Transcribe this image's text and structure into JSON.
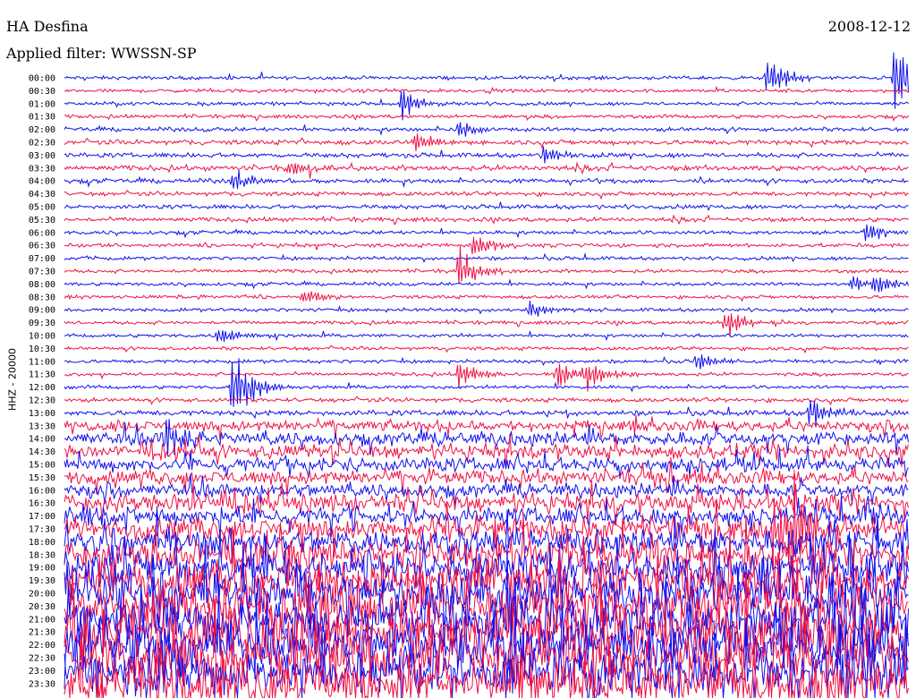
{
  "header": {
    "station": "HA Desfina",
    "date": "2008-12-12",
    "filter": "Applied filter: WWSSN-SP"
  },
  "channel_label": "HHZ - 20000",
  "chart_data": {
    "type": "line",
    "subtype": "helicorder",
    "title": "HA Desfina",
    "date": "2008-12-12",
    "filter": "WWSSN-SP",
    "channel": "HHZ - 20000",
    "row_interval_minutes": 30,
    "row_labels": [
      "00:00",
      "00:30",
      "01:00",
      "01:30",
      "02:00",
      "02:30",
      "03:00",
      "03:30",
      "04:00",
      "04:30",
      "05:00",
      "05:30",
      "06:00",
      "06:30",
      "07:00",
      "07:30",
      "08:00",
      "08:30",
      "09:00",
      "09:30",
      "10:00",
      "10:30",
      "11:00",
      "11:30",
      "12:00",
      "12:30",
      "13:00",
      "13:30",
      "14:00",
      "14:30",
      "15:00",
      "15:30",
      "16:00",
      "16:30",
      "17:00",
      "17:30",
      "18:00",
      "18:30",
      "19:00",
      "19:30",
      "20:00",
      "20:30",
      "21:00",
      "21:30",
      "22:00",
      "22:30",
      "23:00",
      "23:30"
    ],
    "trace_colors": [
      "#1010ee",
      "#ee1144"
    ],
    "noise_level": [
      1,
      1,
      1,
      1,
      1.2,
      1.4,
      1.3,
      1.5,
      1.3,
      1.2,
      1.2,
      1.2,
      1.1,
      1.1,
      1,
      1,
      1,
      1,
      1,
      1,
      1,
      1,
      1,
      1,
      1,
      1.2,
      1.5,
      3,
      4,
      4,
      4,
      4,
      4,
      5,
      5,
      6,
      7,
      8,
      9,
      10,
      11,
      11,
      12,
      12,
      12,
      12,
      12,
      12
    ],
    "events": [
      {
        "row": 0,
        "minute": 29.5,
        "amplitude": 38
      },
      {
        "row": 0,
        "minute": 25,
        "amplitude": 20
      },
      {
        "row": 2,
        "minute": 12,
        "amplitude": 16
      },
      {
        "row": 4,
        "minute": 14,
        "amplitude": 10
      },
      {
        "row": 5,
        "minute": 12.5,
        "amplitude": 12
      },
      {
        "row": 6,
        "minute": 17,
        "amplitude": 10
      },
      {
        "row": 7,
        "minute": 8,
        "amplitude": 10
      },
      {
        "row": 8,
        "minute": 6,
        "amplitude": 12
      },
      {
        "row": 12,
        "minute": 28.5,
        "amplitude": 10
      },
      {
        "row": 13,
        "minute": 14.5,
        "amplitude": 14
      },
      {
        "row": 15,
        "minute": 14,
        "amplitude": 22
      },
      {
        "row": 16,
        "minute": 28,
        "amplitude": 9
      },
      {
        "row": 16,
        "minute": 28.8,
        "amplitude": 9
      },
      {
        "row": 17,
        "minute": 8.5,
        "amplitude": 9
      },
      {
        "row": 18,
        "minute": 16.5,
        "amplitude": 10
      },
      {
        "row": 19,
        "minute": 23.5,
        "amplitude": 16
      },
      {
        "row": 20,
        "minute": 5.5,
        "amplitude": 10
      },
      {
        "row": 22,
        "minute": 22.5,
        "amplitude": 10
      },
      {
        "row": 23,
        "minute": 14,
        "amplitude": 14
      },
      {
        "row": 23,
        "minute": 17.5,
        "amplitude": 16
      },
      {
        "row": 23,
        "minute": 18.5,
        "amplitude": 14
      },
      {
        "row": 24,
        "minute": 6,
        "amplitude": 40
      },
      {
        "row": 26,
        "minute": 26.5,
        "amplitude": 14
      },
      {
        "row": 28,
        "minute": 3.6,
        "amplitude": 24
      },
      {
        "row": 34,
        "minute": 0.6,
        "amplitude": 12
      },
      {
        "row": 34,
        "minute": 28.5,
        "amplitude": 14
      },
      {
        "row": 35,
        "minute": 25.2,
        "amplitude": 40
      },
      {
        "row": 35,
        "minute": 25.8,
        "amplitude": 40
      }
    ]
  }
}
